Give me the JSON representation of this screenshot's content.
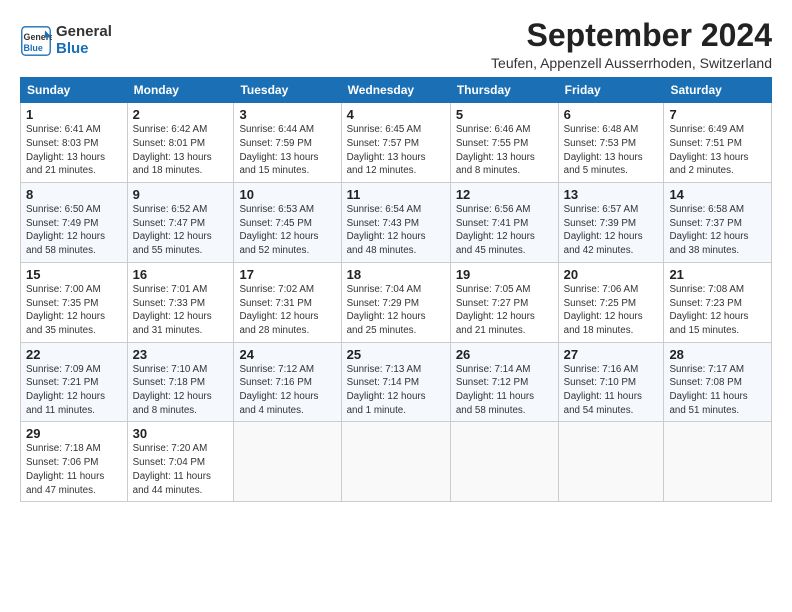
{
  "header": {
    "logo_line1": "General",
    "logo_line2": "Blue",
    "month_year": "September 2024",
    "location": "Teufen, Appenzell Ausserrhoden, Switzerland"
  },
  "days_of_week": [
    "Sunday",
    "Monday",
    "Tuesday",
    "Wednesday",
    "Thursday",
    "Friday",
    "Saturday"
  ],
  "weeks": [
    [
      {
        "day": "1",
        "info": "Sunrise: 6:41 AM\nSunset: 8:03 PM\nDaylight: 13 hours\nand 21 minutes."
      },
      {
        "day": "2",
        "info": "Sunrise: 6:42 AM\nSunset: 8:01 PM\nDaylight: 13 hours\nand 18 minutes."
      },
      {
        "day": "3",
        "info": "Sunrise: 6:44 AM\nSunset: 7:59 PM\nDaylight: 13 hours\nand 15 minutes."
      },
      {
        "day": "4",
        "info": "Sunrise: 6:45 AM\nSunset: 7:57 PM\nDaylight: 13 hours\nand 12 minutes."
      },
      {
        "day": "5",
        "info": "Sunrise: 6:46 AM\nSunset: 7:55 PM\nDaylight: 13 hours\nand 8 minutes."
      },
      {
        "day": "6",
        "info": "Sunrise: 6:48 AM\nSunset: 7:53 PM\nDaylight: 13 hours\nand 5 minutes."
      },
      {
        "day": "7",
        "info": "Sunrise: 6:49 AM\nSunset: 7:51 PM\nDaylight: 13 hours\nand 2 minutes."
      }
    ],
    [
      {
        "day": "8",
        "info": "Sunrise: 6:50 AM\nSunset: 7:49 PM\nDaylight: 12 hours\nand 58 minutes."
      },
      {
        "day": "9",
        "info": "Sunrise: 6:52 AM\nSunset: 7:47 PM\nDaylight: 12 hours\nand 55 minutes."
      },
      {
        "day": "10",
        "info": "Sunrise: 6:53 AM\nSunset: 7:45 PM\nDaylight: 12 hours\nand 52 minutes."
      },
      {
        "day": "11",
        "info": "Sunrise: 6:54 AM\nSunset: 7:43 PM\nDaylight: 12 hours\nand 48 minutes."
      },
      {
        "day": "12",
        "info": "Sunrise: 6:56 AM\nSunset: 7:41 PM\nDaylight: 12 hours\nand 45 minutes."
      },
      {
        "day": "13",
        "info": "Sunrise: 6:57 AM\nSunset: 7:39 PM\nDaylight: 12 hours\nand 42 minutes."
      },
      {
        "day": "14",
        "info": "Sunrise: 6:58 AM\nSunset: 7:37 PM\nDaylight: 12 hours\nand 38 minutes."
      }
    ],
    [
      {
        "day": "15",
        "info": "Sunrise: 7:00 AM\nSunset: 7:35 PM\nDaylight: 12 hours\nand 35 minutes."
      },
      {
        "day": "16",
        "info": "Sunrise: 7:01 AM\nSunset: 7:33 PM\nDaylight: 12 hours\nand 31 minutes."
      },
      {
        "day": "17",
        "info": "Sunrise: 7:02 AM\nSunset: 7:31 PM\nDaylight: 12 hours\nand 28 minutes."
      },
      {
        "day": "18",
        "info": "Sunrise: 7:04 AM\nSunset: 7:29 PM\nDaylight: 12 hours\nand 25 minutes."
      },
      {
        "day": "19",
        "info": "Sunrise: 7:05 AM\nSunset: 7:27 PM\nDaylight: 12 hours\nand 21 minutes."
      },
      {
        "day": "20",
        "info": "Sunrise: 7:06 AM\nSunset: 7:25 PM\nDaylight: 12 hours\nand 18 minutes."
      },
      {
        "day": "21",
        "info": "Sunrise: 7:08 AM\nSunset: 7:23 PM\nDaylight: 12 hours\nand 15 minutes."
      }
    ],
    [
      {
        "day": "22",
        "info": "Sunrise: 7:09 AM\nSunset: 7:21 PM\nDaylight: 12 hours\nand 11 minutes."
      },
      {
        "day": "23",
        "info": "Sunrise: 7:10 AM\nSunset: 7:18 PM\nDaylight: 12 hours\nand 8 minutes."
      },
      {
        "day": "24",
        "info": "Sunrise: 7:12 AM\nSunset: 7:16 PM\nDaylight: 12 hours\nand 4 minutes."
      },
      {
        "day": "25",
        "info": "Sunrise: 7:13 AM\nSunset: 7:14 PM\nDaylight: 12 hours\nand 1 minute."
      },
      {
        "day": "26",
        "info": "Sunrise: 7:14 AM\nSunset: 7:12 PM\nDaylight: 11 hours\nand 58 minutes."
      },
      {
        "day": "27",
        "info": "Sunrise: 7:16 AM\nSunset: 7:10 PM\nDaylight: 11 hours\nand 54 minutes."
      },
      {
        "day": "28",
        "info": "Sunrise: 7:17 AM\nSunset: 7:08 PM\nDaylight: 11 hours\nand 51 minutes."
      }
    ],
    [
      {
        "day": "29",
        "info": "Sunrise: 7:18 AM\nSunset: 7:06 PM\nDaylight: 11 hours\nand 47 minutes."
      },
      {
        "day": "30",
        "info": "Sunrise: 7:20 AM\nSunset: 7:04 PM\nDaylight: 11 hours\nand 44 minutes."
      },
      {
        "day": "",
        "info": ""
      },
      {
        "day": "",
        "info": ""
      },
      {
        "day": "",
        "info": ""
      },
      {
        "day": "",
        "info": ""
      },
      {
        "day": "",
        "info": ""
      }
    ]
  ]
}
